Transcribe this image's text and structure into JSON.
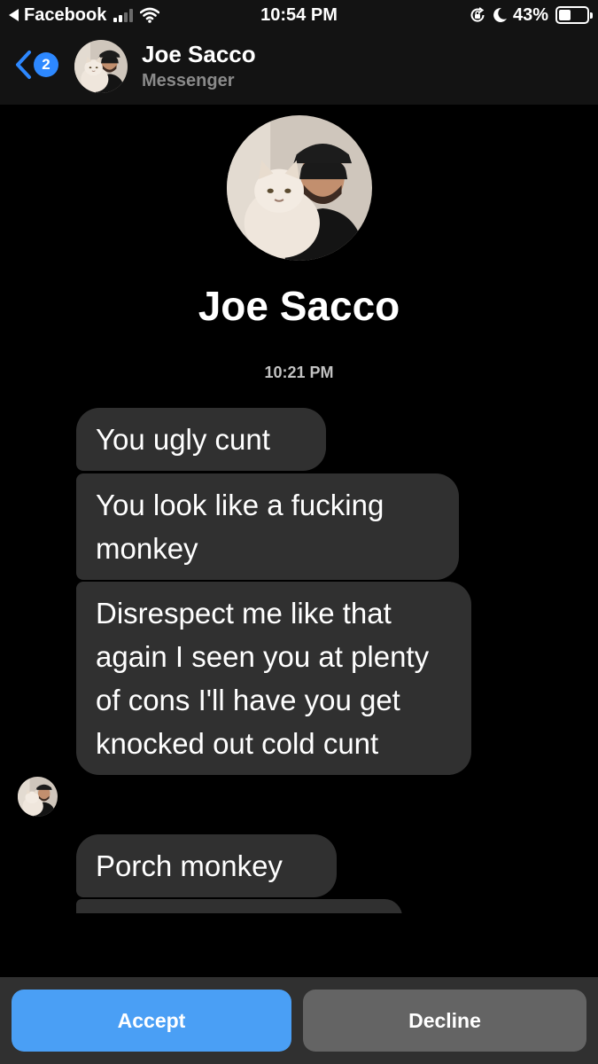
{
  "status_bar": {
    "back_app": "Facebook",
    "time": "10:54 PM",
    "battery_percent": "43%",
    "battery_level": 0.43,
    "signal_bars_filled": 2,
    "signal_bars_total": 4
  },
  "header": {
    "back_badge_count": "2",
    "contact_name": "Joe Sacco",
    "subtitle": "Messenger"
  },
  "profile": {
    "name": "Joe Sacco"
  },
  "conversation": {
    "timestamp": "10:21 PM",
    "messages": [
      {
        "text": "You ugly cunt"
      },
      {
        "text": "You look like a fucking monkey"
      },
      {
        "text": "Disrespect me like that again I seen you at plenty of cons I'll have you get knocked out cold cunt"
      },
      {
        "text": "Porch monkey"
      },
      {
        "text": ""
      }
    ]
  },
  "actions": {
    "accept_label": "Accept",
    "decline_label": "Decline"
  },
  "colors": {
    "background": "#000000",
    "bar_background": "#131313",
    "bubble": "#303030",
    "accent": "#2d88ff",
    "accept": "#4a9ff5",
    "decline": "#646464"
  },
  "icons": [
    "back-arrow-icon",
    "signal-icon",
    "wifi-icon",
    "orientation-lock-icon",
    "moon-icon",
    "battery-icon",
    "chevron-left-icon"
  ]
}
